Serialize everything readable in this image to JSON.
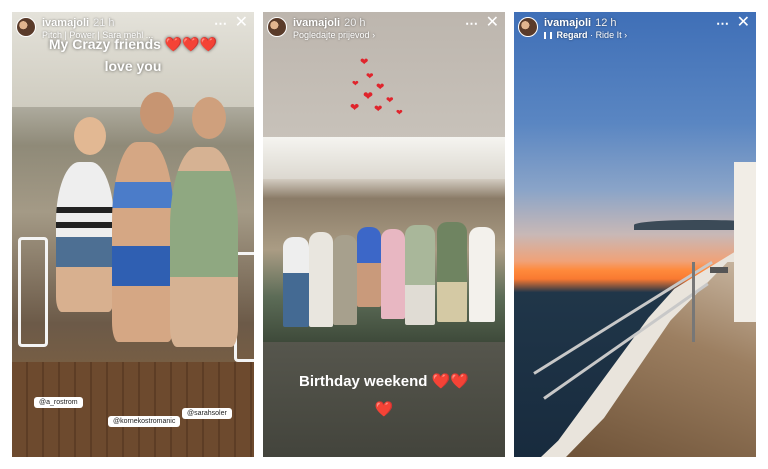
{
  "stories": [
    {
      "username": "ivamajoli",
      "time": "21 h",
      "subline": "Pitch | Power | Sara mehl ...",
      "overlay_text_line1": "My Crazy friends",
      "overlay_hearts_line1": "❤️❤️❤️",
      "overlay_text_line2": "love you",
      "tags": [
        "@a_rostrom",
        "@kornekostromanic",
        "@sarahsoler"
      ]
    },
    {
      "username": "ivamajoli",
      "time": "20 h",
      "subline": "Pogledajte prijevod",
      "subline_chevron": "›",
      "caption": "Birthday weekend",
      "caption_hearts": "❤️❤️",
      "caption_heart_line2": "❤️"
    },
    {
      "username": "ivamajoli",
      "time": "12 h",
      "music_icon": "music-bars-icon",
      "music_artist": "Regard",
      "music_sep": "·",
      "music_track": "Ride It",
      "music_chevron": "›"
    }
  ],
  "icons": {
    "more": "⋯",
    "close": "✕"
  },
  "colors": {
    "heart": "#e0242c",
    "sunset": "#f97931",
    "sky_top": "#3f6fb7"
  }
}
